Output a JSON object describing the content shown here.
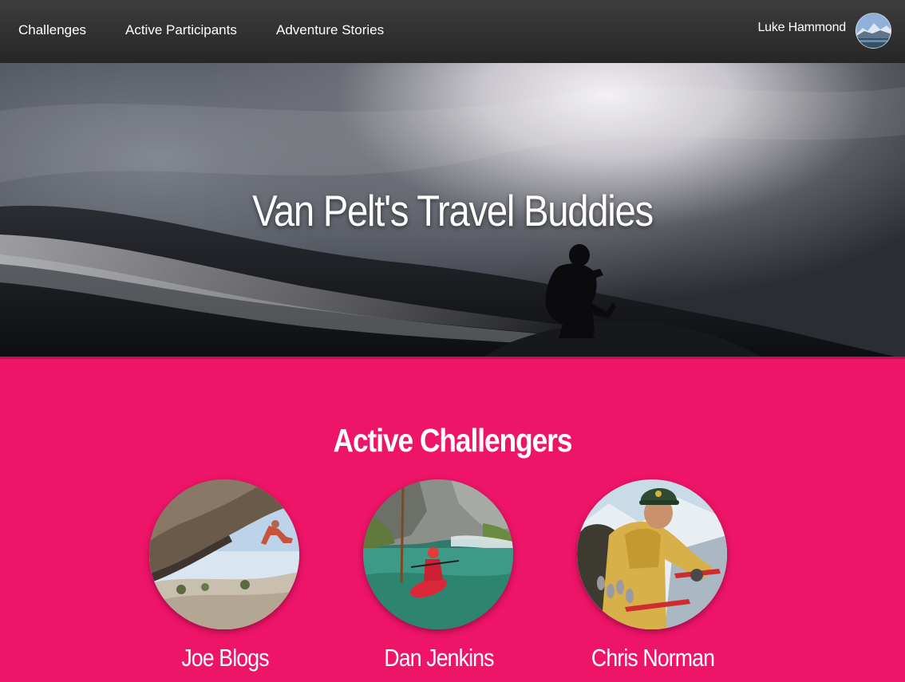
{
  "nav": {
    "links": [
      {
        "label": "Challenges"
      },
      {
        "label": "Active Participants"
      },
      {
        "label": "Adventure Stories"
      }
    ],
    "user_name": "Luke Hammond"
  },
  "hero": {
    "title": "Van Pelt's Travel Buddies"
  },
  "challengers": {
    "heading": "Active Challengers",
    "people": [
      {
        "name": "Joe Blogs"
      },
      {
        "name": "Dan Jenkins"
      },
      {
        "name": "Chris Norman"
      }
    ]
  },
  "colors": {
    "accent": "#ee1468",
    "navbar": "#2f2f2f"
  },
  "icons": {
    "avatar": "mountain-lake-avatar"
  }
}
